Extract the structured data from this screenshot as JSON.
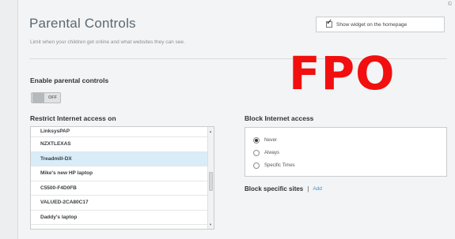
{
  "header": {
    "title": "Parental Controls",
    "subtitle": "Limit when your children get online and what websites they can see.",
    "widget_checkbox_label": "Show widget on the homepage",
    "widget_checkbox_checked": true
  },
  "overlay": {
    "fpo_text": "FPO",
    "fpo_color": "#f20f0f"
  },
  "enable_section": {
    "label": "Enable parental controls",
    "toggle_state": "OFF"
  },
  "restrict_section": {
    "label": "Restrict Internet access on",
    "devices": [
      "LinksysPAP",
      "NZXTLEXAS",
      "Treadmill-DX",
      "Mike's new HP laptop",
      "C5500-F4D0FB",
      "VALUED-2CA80C17",
      "Daddy's laptop"
    ],
    "selected_index": 2
  },
  "block_section": {
    "label": "Block Internet access",
    "options": [
      "Never",
      "Always",
      "Specific Times"
    ],
    "selected_index": 0
  },
  "sites_section": {
    "label": "Block specific sites",
    "separator": "|",
    "add_link": "Add"
  },
  "colors": {
    "accent_link": "#3b8fd1",
    "selected_row": "#d9edf8"
  }
}
